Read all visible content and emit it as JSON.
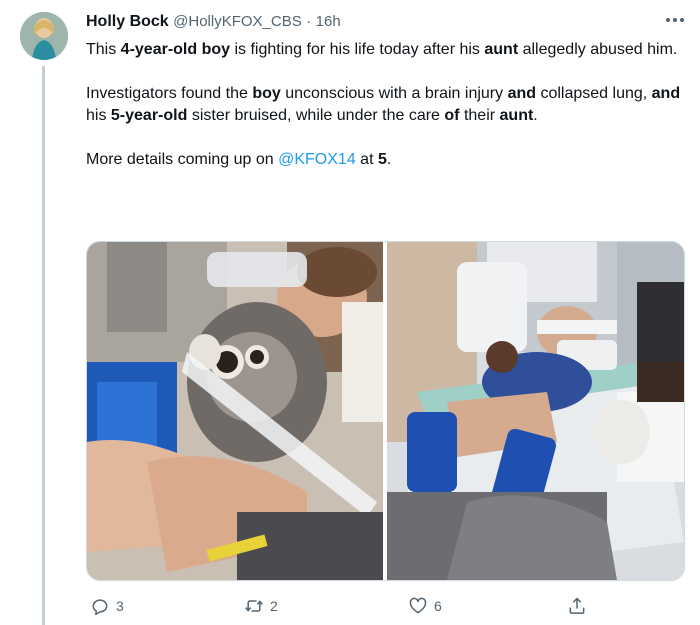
{
  "author": {
    "name": "Holly Bock",
    "handle": "@HollyKFOX_CBS",
    "separator": "·",
    "time": "16h"
  },
  "tweet": {
    "p1": [
      {
        "t": "This ",
        "b": false
      },
      {
        "t": "4-year-old boy",
        "b": true
      },
      {
        "t": " is fighting for his life today after his ",
        "b": false
      },
      {
        "t": "aunt",
        "b": true
      },
      {
        "t": " allegedly abused him.",
        "b": false
      }
    ],
    "p2": [
      {
        "t": "Investigators found the ",
        "b": false
      },
      {
        "t": "boy",
        "b": true
      },
      {
        "t": " unconscious with a brain injury ",
        "b": false
      },
      {
        "t": "and",
        "b": true
      },
      {
        "t": " collapsed lung, ",
        "b": false
      },
      {
        "t": "and",
        "b": true
      },
      {
        "t": " his ",
        "b": false
      },
      {
        "t": "5-year-old",
        "b": true
      },
      {
        "t": " sister bruised, while under the care ",
        "b": false
      },
      {
        "t": "of",
        "b": true
      },
      {
        "t": " their ",
        "b": false
      },
      {
        "t": "aunt",
        "b": true
      },
      {
        "t": ".",
        "b": false
      }
    ],
    "p3": [
      {
        "t": "More details coming up on ",
        "b": false
      },
      {
        "t": "@KFOX14",
        "b": false,
        "mention": true
      },
      {
        "t": " at ",
        "b": false
      },
      {
        "t": "5",
        "b": true
      },
      {
        "t": ".",
        "b": false
      }
    ]
  },
  "actions": {
    "replies": "3",
    "retweets": "2",
    "likes": "6"
  },
  "icons": {
    "more": "more-horizontal-icon",
    "reply": "reply-icon",
    "retweet": "retweet-icon",
    "like": "heart-icon",
    "share": "share-icon"
  },
  "colors": {
    "accent": "#1d9bf0",
    "secondary_text": "#536471",
    "primary_text": "#0f1419"
  }
}
